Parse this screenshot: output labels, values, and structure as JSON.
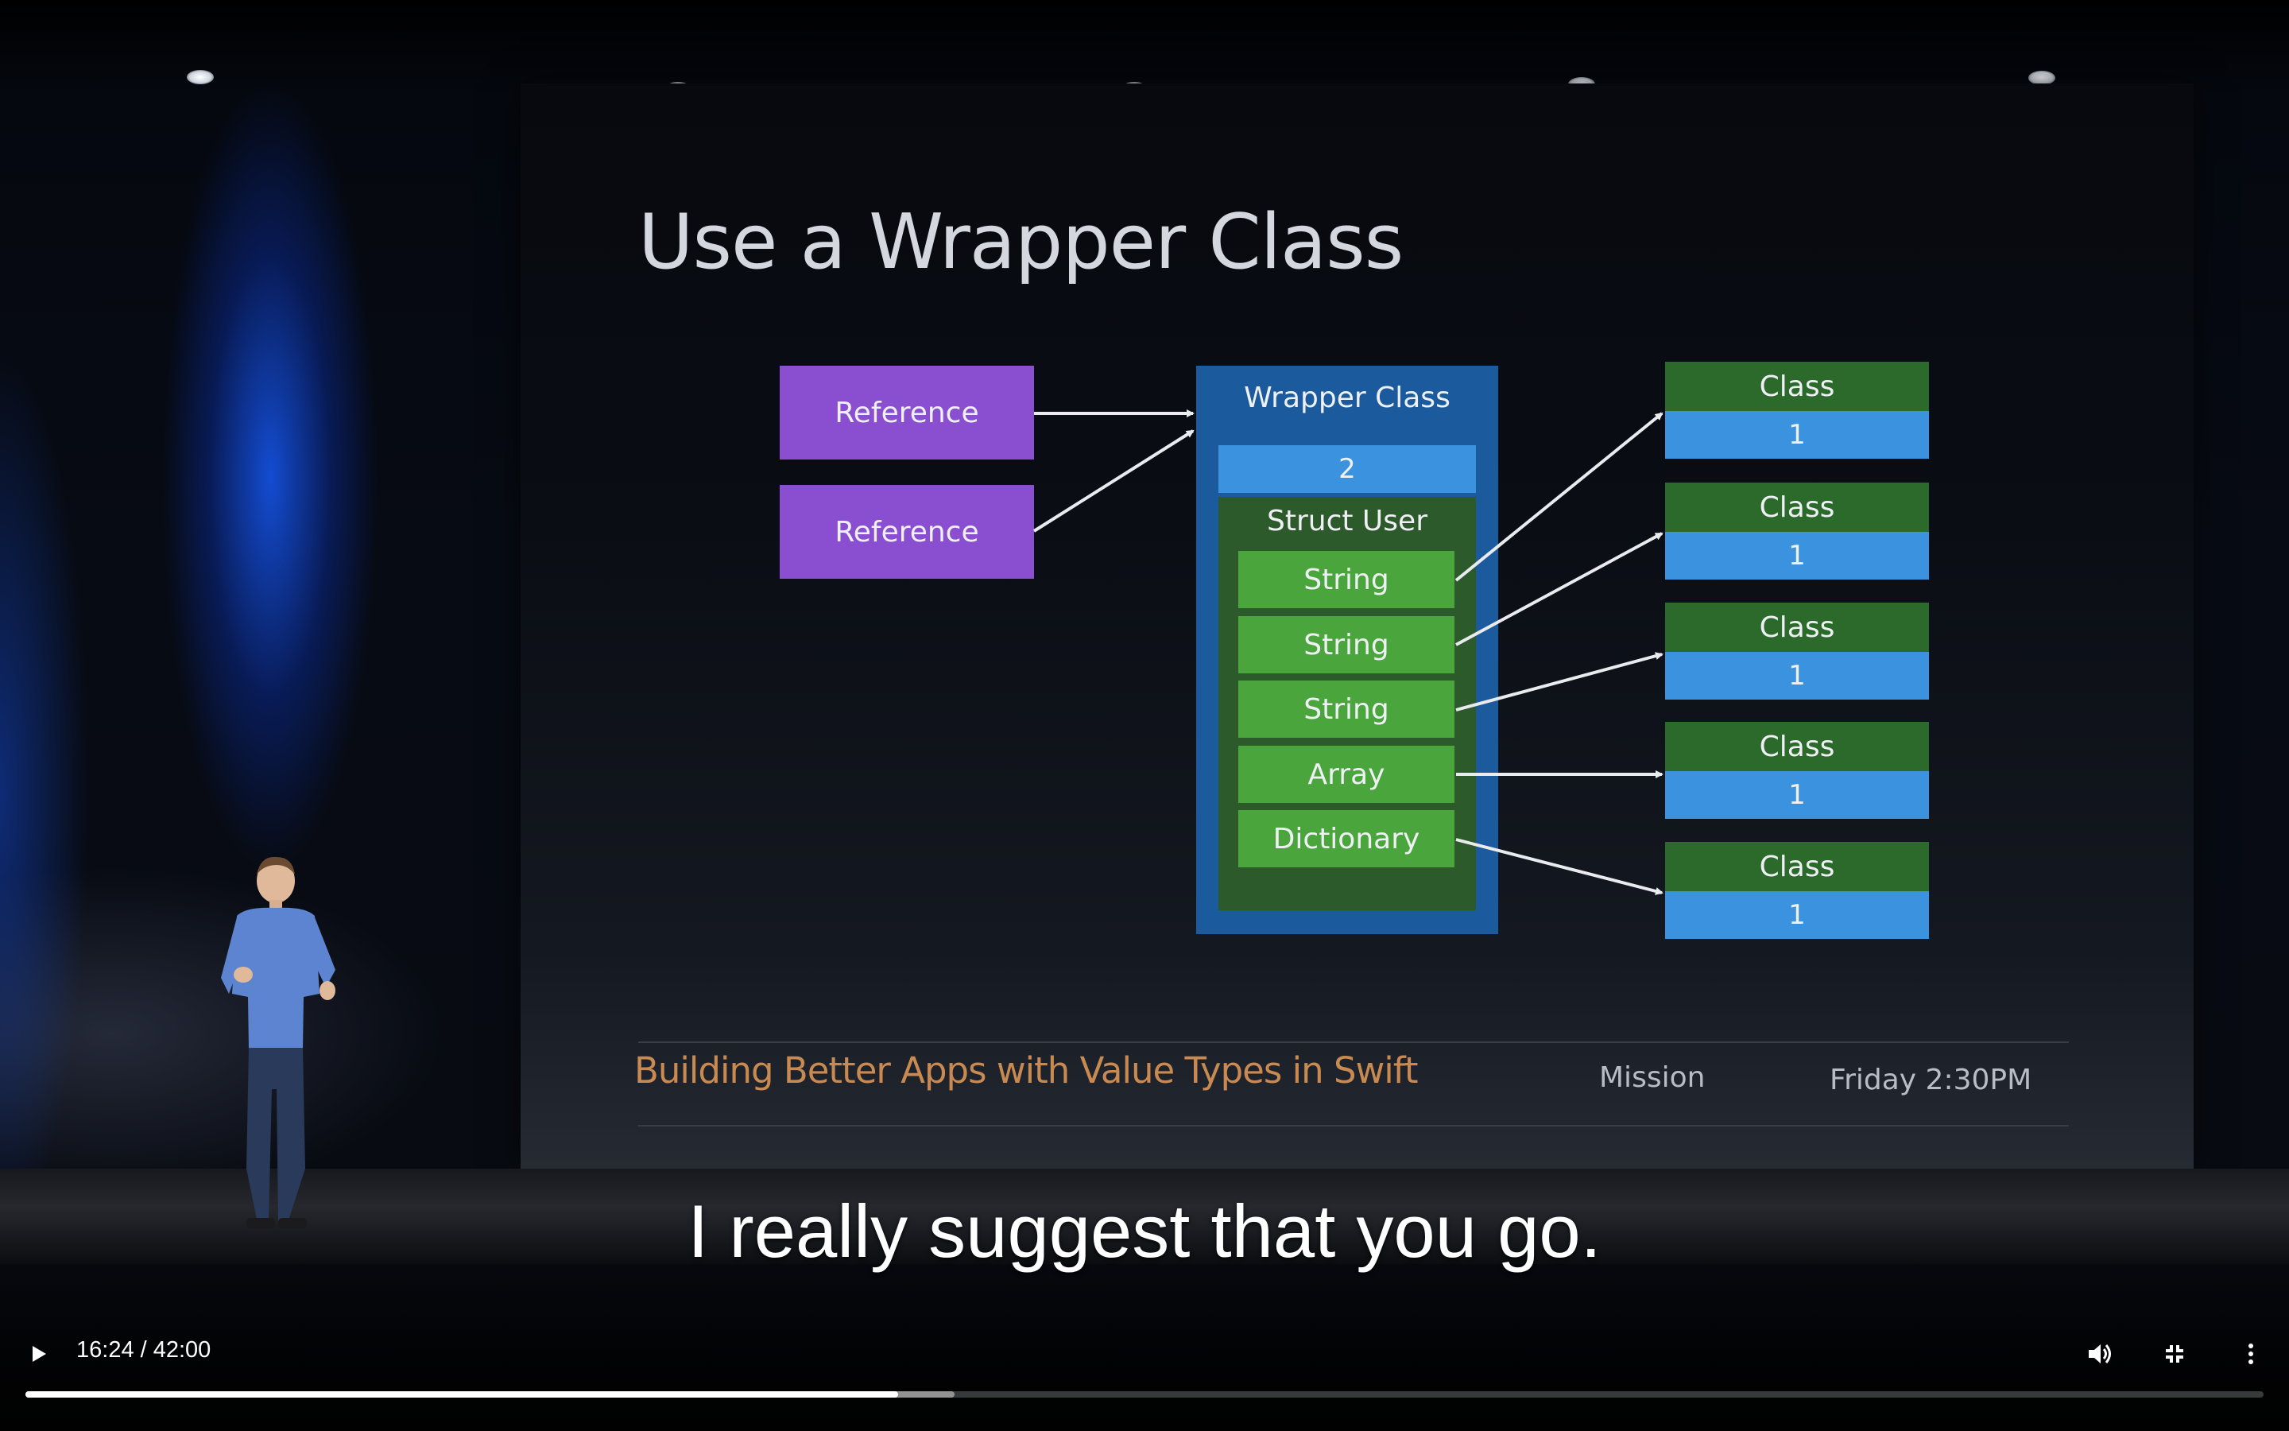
{
  "slide": {
    "title": "Use a Wrapper Class",
    "references": [
      "Reference",
      "Reference"
    ],
    "wrapper": {
      "label": "Wrapper Class",
      "ref_count": "2",
      "struct_label": "Struct User",
      "fields": [
        "String",
        "String",
        "String",
        "Array",
        "Dictionary"
      ]
    },
    "classes": [
      {
        "label": "Class",
        "count": "1"
      },
      {
        "label": "Class",
        "count": "1"
      },
      {
        "label": "Class",
        "count": "1"
      },
      {
        "label": "Class",
        "count": "1"
      },
      {
        "label": "Class",
        "count": "1"
      }
    ],
    "footer": {
      "session_title": "Building Better Apps with Value Types in Swift",
      "room": "Mission",
      "time": "Friday 2:30PM"
    }
  },
  "caption": "I really suggest that you go.",
  "player": {
    "time_display": "16:24 / 42:00",
    "played_fraction": 0.39,
    "buffered_fraction": 0.415,
    "icons": [
      "play-icon",
      "volume-icon",
      "exit-fullscreen-icon",
      "more-vert-icon"
    ]
  },
  "colors": {
    "reference": "#8a4fd0",
    "wrapper": "#1b5a9d",
    "count": "#3b93e0",
    "struct": "#2c5a2a",
    "field": "#4aa63c",
    "class_head": "#2b6a2b",
    "session_title": "#c98a52"
  }
}
